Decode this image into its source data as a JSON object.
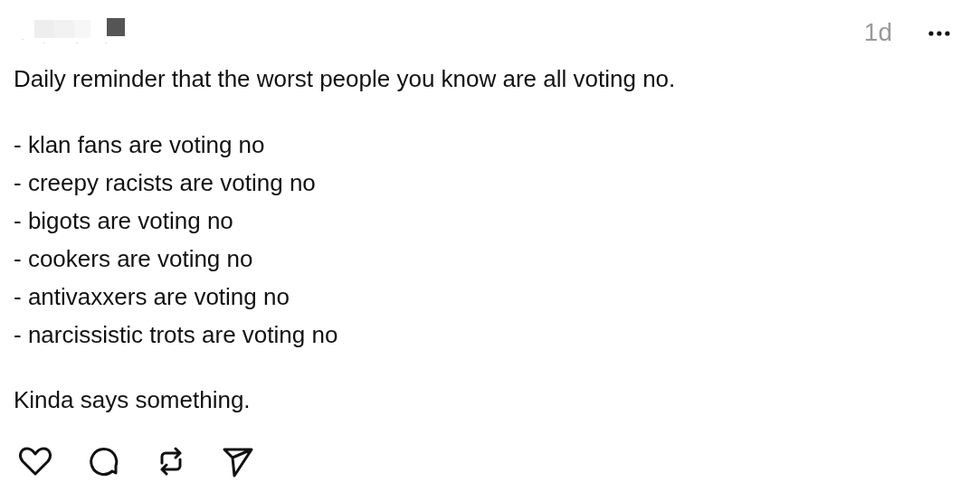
{
  "post": {
    "time": "1d",
    "intro": "Daily reminder that the worst people you know are all voting no.",
    "list": [
      "- klan fans are voting no",
      "- creepy racists are voting no",
      "- bigots are voting no",
      "- cookers are voting no",
      "- antivaxxers are voting no",
      "- narcissistic trots are voting no"
    ],
    "closing": "Kinda says something."
  }
}
